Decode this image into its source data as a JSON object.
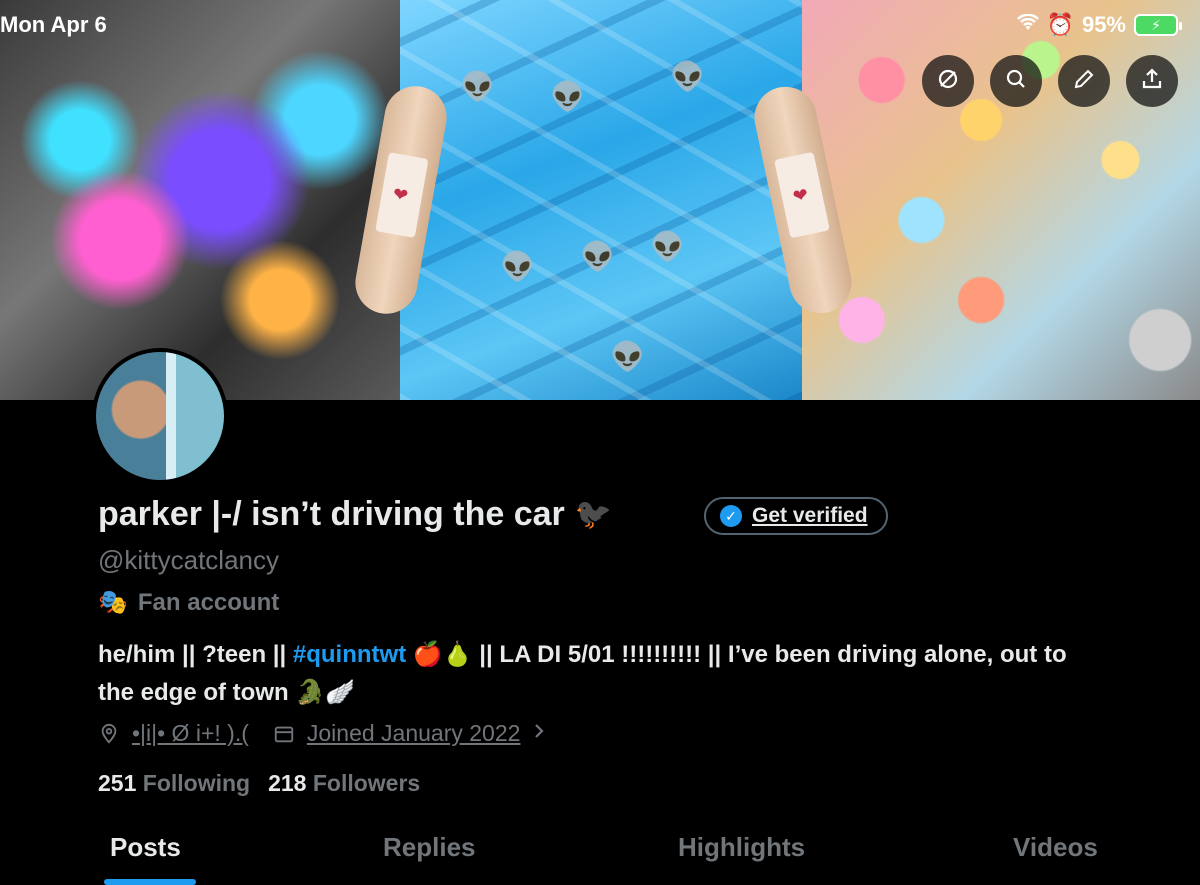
{
  "status_bar": {
    "time": "Mon Apr 6",
    "battery_percent": "95%",
    "battery_level": 0.95,
    "icons": [
      "wifi-icon",
      "alarm-icon",
      "battery-charging-icon"
    ]
  },
  "header_actions": [
    {
      "icon": "no-sync-icon"
    },
    {
      "icon": "search-icon"
    },
    {
      "icon": "edit-pencil-icon"
    },
    {
      "icon": "share-icon"
    }
  ],
  "banner": {
    "panels": [
      "chalk-art",
      "alien-toys",
      "candy-and-ashtray"
    ]
  },
  "profile": {
    "display_name": "parker |-/ isn’t driving the car",
    "name_emoji": "🐦‍⬛",
    "handle": "@kittycatclancy",
    "category_icon": "🎭",
    "category": "Fan account",
    "verify_button": "Get verified",
    "bio_part1": "he/him || ?teen || ",
    "bio_hashtag": "#quinntwt",
    "bio_part2": " 🍎🍐 || LA DI 5/01 !!!!!!!!!! || I’ve been driving alone, out to the edge of town 🐊🪽",
    "location": "•|i|• Ø i+! ).(",
    "joined": "Joined January 2022",
    "following_count": "251",
    "following_label": "Following",
    "followers_count": "218",
    "followers_label": "Followers"
  },
  "tabs": [
    {
      "label": "Posts",
      "active": true
    },
    {
      "label": "Replies",
      "active": false
    },
    {
      "label": "Highlights",
      "active": false
    },
    {
      "label": "Videos",
      "active": false
    }
  ],
  "colors": {
    "accent": "#1d9bf0",
    "text_primary": "#e7e9ea",
    "text_secondary": "#71767b",
    "background": "#000000"
  }
}
